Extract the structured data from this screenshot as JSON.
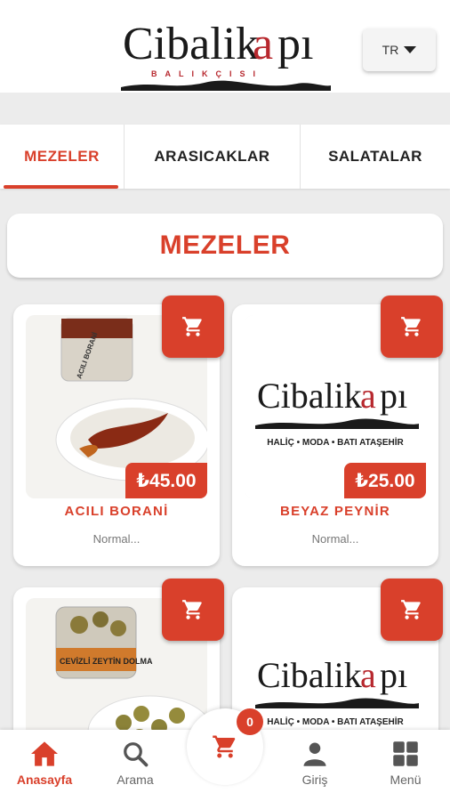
{
  "header": {
    "brand": "Cibalikapı",
    "brand_sub": "BALIKÇISI",
    "language": "TR"
  },
  "tabs": [
    {
      "label": "MEZELER",
      "active": true
    },
    {
      "label": "ARASICAKLAR",
      "active": false
    },
    {
      "label": "SALATALAR",
      "active": false
    }
  ],
  "section": {
    "title": "MEZELER"
  },
  "products": [
    {
      "name": "ACILI BORANİ",
      "price": "₺45.00",
      "desc": "Normal...",
      "jar_label": "ACILI BORANİ"
    },
    {
      "name": "BEYAZ PEYNİR",
      "price": "₺25.00",
      "desc": "Normal...",
      "logo_sub": "HALİÇ • MODA • BATI ATAŞEHİR"
    },
    {
      "name": "",
      "price": "",
      "desc": "",
      "jar_label": "CEVİZLİ ZEYTİN DOLMA"
    },
    {
      "name": "",
      "price": "",
      "desc": "",
      "logo_sub": "HALİÇ • MODA • BATI ATAŞEHİR"
    }
  ],
  "bottom_nav": {
    "home": "Anasayfa",
    "search": "Arama",
    "cart_count": "0",
    "login": "Giriş",
    "menu": "Menü"
  },
  "colors": {
    "accent": "#d9402b"
  }
}
